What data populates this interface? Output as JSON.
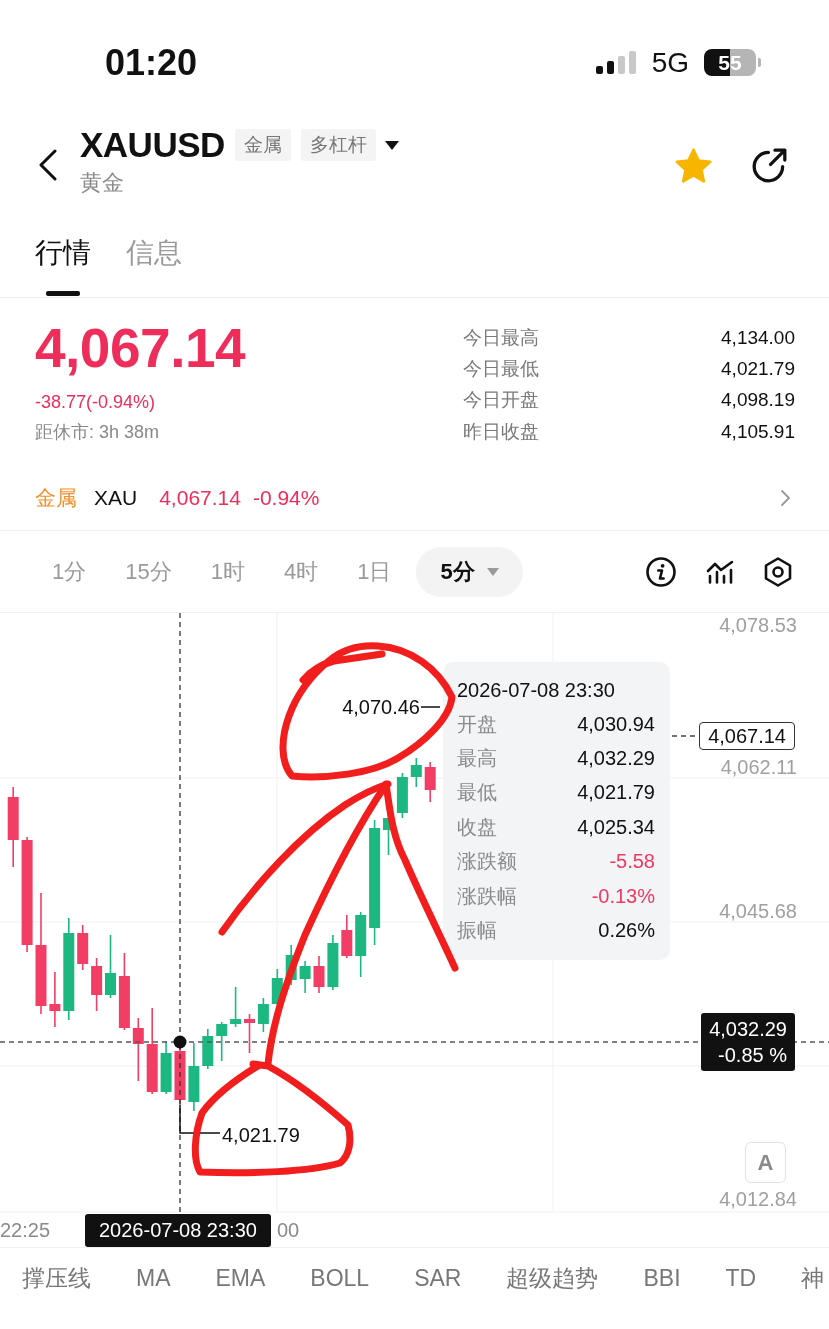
{
  "status_bar": {
    "time": "01:20",
    "network": "5G",
    "battery": "55"
  },
  "header": {
    "symbol": "XAUUSD",
    "tags": [
      "金属",
      "多杠杆"
    ],
    "subtitle": "黄金",
    "favorite": true
  },
  "tabs": [
    {
      "label": "行情",
      "selected": true
    },
    {
      "label": "信息",
      "selected": false
    }
  ],
  "quote": {
    "price": "4,067.14",
    "change": "-38.77(-0.94%)",
    "countdown": "距休市: 3h 38m",
    "stats": [
      {
        "label": "今日最高",
        "value": "4,134.00"
      },
      {
        "label": "今日最低",
        "value": "4,021.79"
      },
      {
        "label": "今日开盘",
        "value": "4,098.19"
      },
      {
        "label": "昨日收盘",
        "value": "4,105.91"
      }
    ]
  },
  "related": {
    "category": "金属",
    "symbol": "XAU",
    "price": "4,067.14",
    "change": "-0.94%"
  },
  "timeframes": [
    {
      "label": "1分",
      "selected": false,
      "kind": "option"
    },
    {
      "label": "15分",
      "selected": false,
      "kind": "option"
    },
    {
      "label": "1时",
      "selected": false,
      "kind": "option"
    },
    {
      "label": "4时",
      "selected": false,
      "kind": "option"
    },
    {
      "label": "1日",
      "selected": false,
      "kind": "option"
    },
    {
      "label": "5分",
      "selected": true,
      "kind": "dropdown"
    }
  ],
  "chart": {
    "y_axis_labels": [
      "4,078.53",
      "4,062.11",
      "4,045.68",
      "4,012.84"
    ],
    "last_price": "4,067.14",
    "high_marker": "4,070.46",
    "low_marker": "4,021.79",
    "crosshair": {
      "time": "2026-07-08 23:30",
      "price": "4,032.29",
      "change": "-0.85 %"
    },
    "x_axis_labels": [
      "22:25",
      "00"
    ],
    "tooltip": {
      "time": "2026-07-08 23:30",
      "rows": [
        {
          "label": "开盘",
          "value": "4,030.94",
          "color": "#111111"
        },
        {
          "label": "最高",
          "value": "4,032.29",
          "color": "#111111"
        },
        {
          "label": "最低",
          "value": "4,021.79",
          "color": "#111111"
        },
        {
          "label": "收盘",
          "value": "4,025.34",
          "color": "#111111"
        },
        {
          "label": "涨跌额",
          "value": "-5.58",
          "color": "#ee3a62"
        },
        {
          "label": "涨跌幅",
          "value": "-0.13%",
          "color": "#ee3a62"
        },
        {
          "label": "振幅",
          "value": "0.26%",
          "color": "#111111"
        }
      ]
    },
    "scale_button": "A"
  },
  "indicators": [
    "撑压线",
    "MA",
    "EMA",
    "BOLL",
    "SAR",
    "超级趋势",
    "BBI",
    "TD",
    "神"
  ]
}
